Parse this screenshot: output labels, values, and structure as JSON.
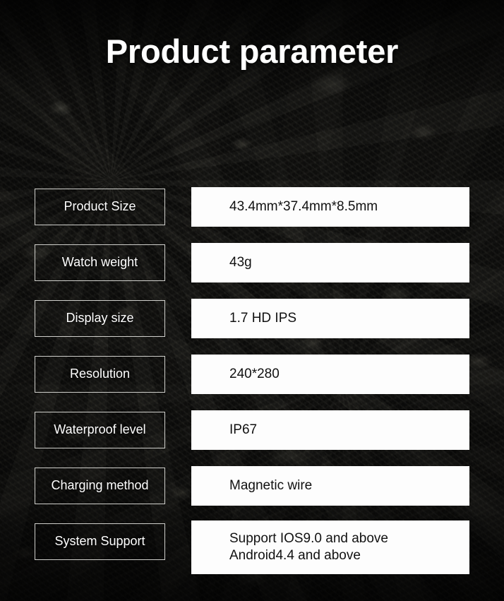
{
  "page": {
    "title": "Product parameter",
    "background_color": "#0b0b0a",
    "accent_text_color": "#ffffff",
    "value_box_color": "#fdfdfd",
    "value_text_color": "#111111",
    "label_border_color": "#cfcfcb"
  },
  "spec_rows": [
    {
      "label": "Product Size",
      "value_lines": [
        "43.4mm*37.4mm*8.5mm"
      ]
    },
    {
      "label": "Watch weight",
      "value_lines": [
        "43g"
      ]
    },
    {
      "label": "Display size",
      "value_lines": [
        "1.7 HD IPS"
      ]
    },
    {
      "label": "Resolution",
      "value_lines": [
        "240*280"
      ]
    },
    {
      "label": "Waterproof level",
      "value_lines": [
        "IP67"
      ]
    },
    {
      "label": "Charging method",
      "value_lines": [
        "Magnetic wire"
      ]
    },
    {
      "label": "System Support",
      "value_lines": [
        "Support IOS9.0 and above",
        "Android4.4 and above"
      ]
    }
  ]
}
